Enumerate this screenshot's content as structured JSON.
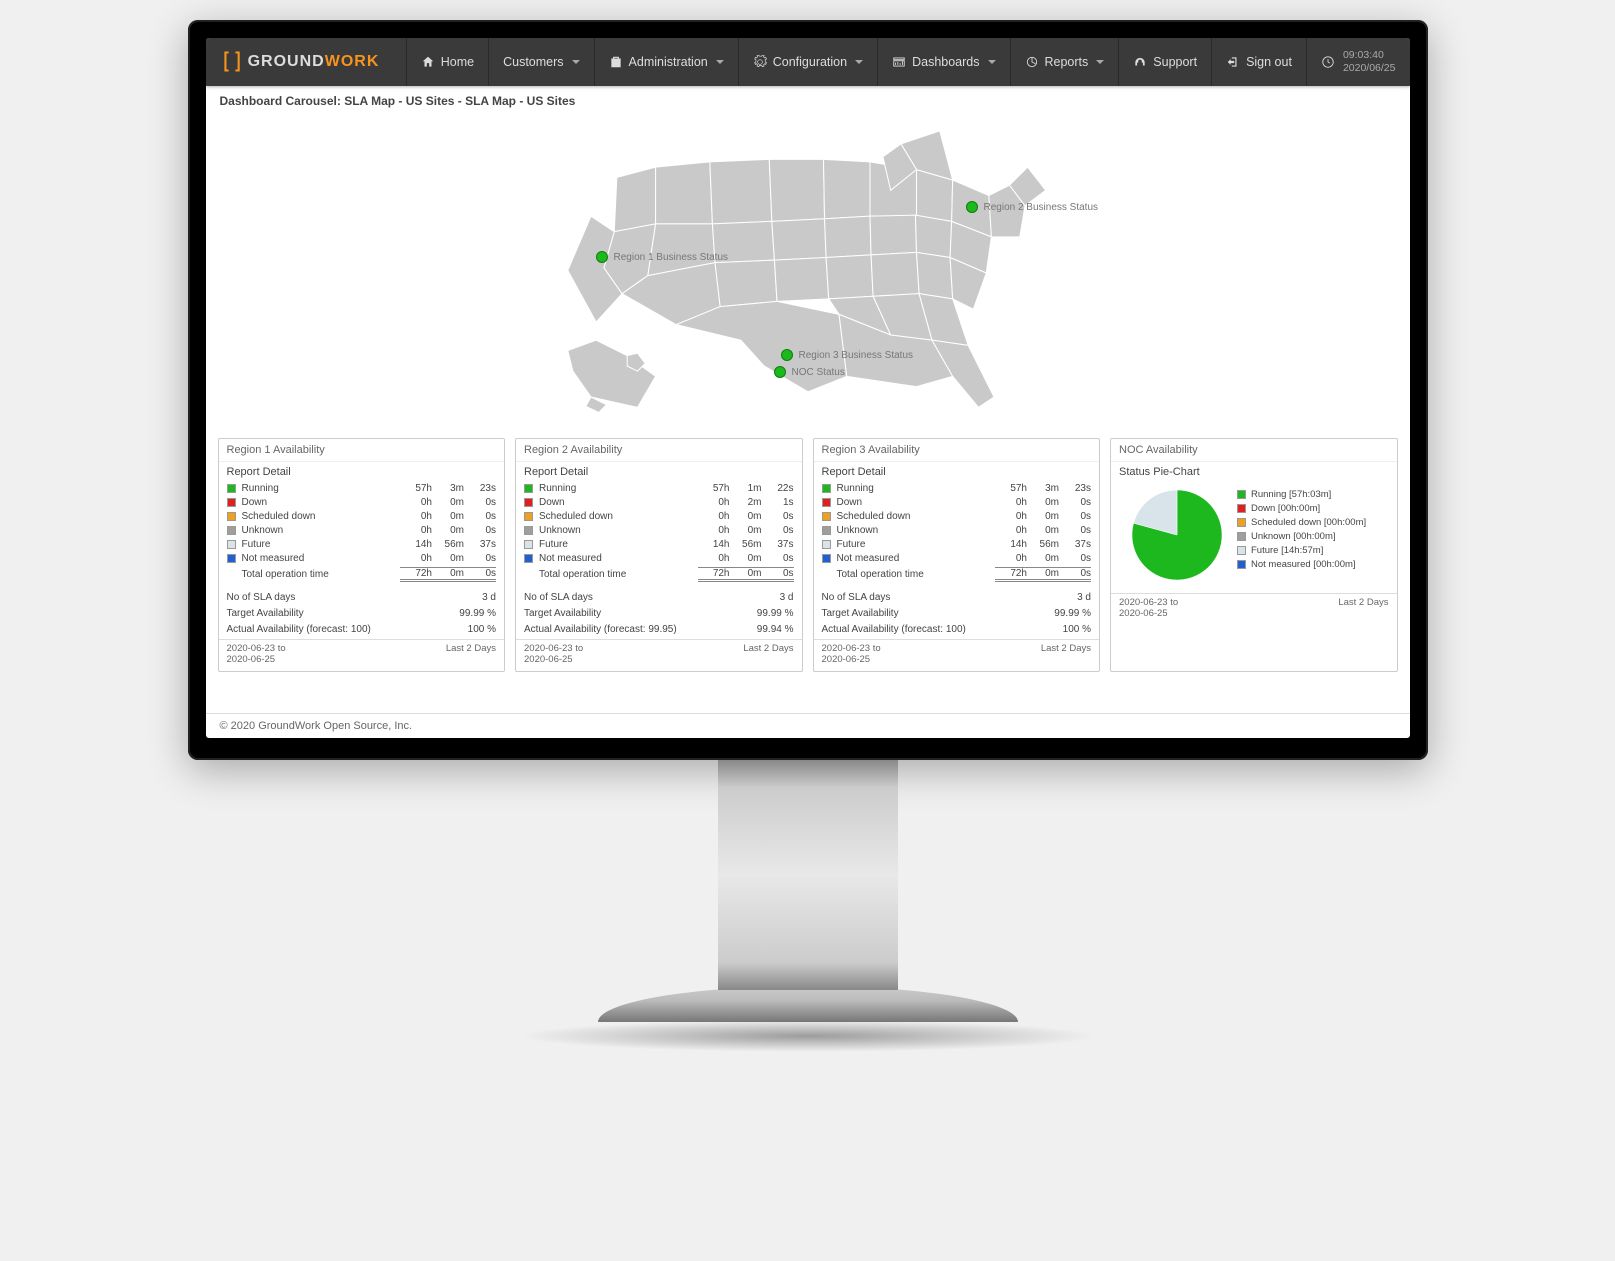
{
  "logo": {
    "text1": "GROUND",
    "text2": "WORK"
  },
  "nav": {
    "home": "Home",
    "customers": "Customers",
    "administration": "Administration",
    "configuration": "Configuration",
    "dashboards": "Dashboards",
    "reports": "Reports",
    "support": "Support",
    "signout": "Sign out"
  },
  "clock": {
    "time": "09:03:40",
    "date": "2020/06/25"
  },
  "breadcrumb": "Dashboard Carousel: SLA Map - US Sites - SLA Map - US Sites",
  "map_pins": {
    "r1": "Region 1 Business Status",
    "r2": "Region 2 Business Status",
    "r3": "Region 3 Business Status",
    "noc": "NOC Status"
  },
  "status_colors": {
    "running": "#1db81d",
    "down": "#e02020",
    "scheduled": "#f0a020",
    "unknown": "#9e9e9e",
    "future": "#d8e4ea",
    "notmeasured": "#2060d0"
  },
  "row_labels": {
    "running": "Running",
    "down": "Down",
    "scheduled": "Scheduled down",
    "unknown": "Unknown",
    "future": "Future",
    "notmeasured": "Not measured",
    "total": "Total operation time",
    "sla_days": "No of SLA days",
    "target": "Target Availability",
    "report_detail": "Report Detail"
  },
  "regions": [
    {
      "title": "Region 1 Availability",
      "rows": {
        "running": {
          "h": "57h",
          "m": "3m",
          "s": "23s"
        },
        "down": {
          "h": "0h",
          "m": "0m",
          "s": "0s"
        },
        "scheduled": {
          "h": "0h",
          "m": "0m",
          "s": "0s"
        },
        "unknown": {
          "h": "0h",
          "m": "0m",
          "s": "0s"
        },
        "future": {
          "h": "14h",
          "m": "56m",
          "s": "37s"
        },
        "notmeasured": {
          "h": "0h",
          "m": "0m",
          "s": "0s"
        },
        "total": {
          "h": "72h",
          "m": "0m",
          "s": "0s"
        }
      },
      "sla_days": "3 d",
      "target": "99.99 %",
      "actual_label": "Actual Availability (forecast: 100)",
      "actual": "100 %",
      "range": "2020-06-23 to\n2020-06-25",
      "range_label": "Last 2 Days"
    },
    {
      "title": "Region 2 Availability",
      "rows": {
        "running": {
          "h": "57h",
          "m": "1m",
          "s": "22s"
        },
        "down": {
          "h": "0h",
          "m": "2m",
          "s": "1s"
        },
        "scheduled": {
          "h": "0h",
          "m": "0m",
          "s": "0s"
        },
        "unknown": {
          "h": "0h",
          "m": "0m",
          "s": "0s"
        },
        "future": {
          "h": "14h",
          "m": "56m",
          "s": "37s"
        },
        "notmeasured": {
          "h": "0h",
          "m": "0m",
          "s": "0s"
        },
        "total": {
          "h": "72h",
          "m": "0m",
          "s": "0s"
        }
      },
      "sla_days": "3 d",
      "target": "99.99 %",
      "actual_label": "Actual Availability (forecast: 99.95)",
      "actual": "99.94 %",
      "range": "2020-06-23 to\n2020-06-25",
      "range_label": "Last 2 Days"
    },
    {
      "title": "Region 3 Availability",
      "rows": {
        "running": {
          "h": "57h",
          "m": "3m",
          "s": "23s"
        },
        "down": {
          "h": "0h",
          "m": "0m",
          "s": "0s"
        },
        "scheduled": {
          "h": "0h",
          "m": "0m",
          "s": "0s"
        },
        "unknown": {
          "h": "0h",
          "m": "0m",
          "s": "0s"
        },
        "future": {
          "h": "14h",
          "m": "56m",
          "s": "37s"
        },
        "notmeasured": {
          "h": "0h",
          "m": "0m",
          "s": "0s"
        },
        "total": {
          "h": "72h",
          "m": "0m",
          "s": "0s"
        }
      },
      "sla_days": "3 d",
      "target": "99.99 %",
      "actual_label": "Actual Availability (forecast: 100)",
      "actual": "100 %",
      "range": "2020-06-23 to\n2020-06-25",
      "range_label": "Last 2 Days"
    }
  ],
  "noc": {
    "title": "NOC Availability",
    "subtitle": "Status Pie-Chart",
    "legend": [
      {
        "color": "#1db81d",
        "label": "Running [57h:03m]"
      },
      {
        "color": "#e02020",
        "label": "Down [00h:00m]"
      },
      {
        "color": "#f0a020",
        "label": "Scheduled down [00h:00m]"
      },
      {
        "color": "#9e9e9e",
        "label": "Unknown [00h:00m]"
      },
      {
        "color": "#d8e4ea",
        "label": "Future [14h:57m]"
      },
      {
        "color": "#2060d0",
        "label": "Not measured [00h:00m]"
      }
    ],
    "range": "2020-06-23 to\n2020-06-25",
    "range_label": "Last 2 Days"
  },
  "chart_data": {
    "type": "pie",
    "title": "NOC Availability — Status Pie-Chart",
    "series": [
      {
        "name": "Running",
        "value": 57.05,
        "unit": "hours",
        "color": "#1db81d"
      },
      {
        "name": "Down",
        "value": 0,
        "unit": "hours",
        "color": "#e02020"
      },
      {
        "name": "Scheduled down",
        "value": 0,
        "unit": "hours",
        "color": "#f0a020"
      },
      {
        "name": "Unknown",
        "value": 0,
        "unit": "hours",
        "color": "#9e9e9e"
      },
      {
        "name": "Future",
        "value": 14.95,
        "unit": "hours",
        "color": "#d8e4ea"
      },
      {
        "name": "Not measured",
        "value": 0,
        "unit": "hours",
        "color": "#2060d0"
      }
    ]
  },
  "footer": "© 2020 GroundWork Open Source, Inc."
}
